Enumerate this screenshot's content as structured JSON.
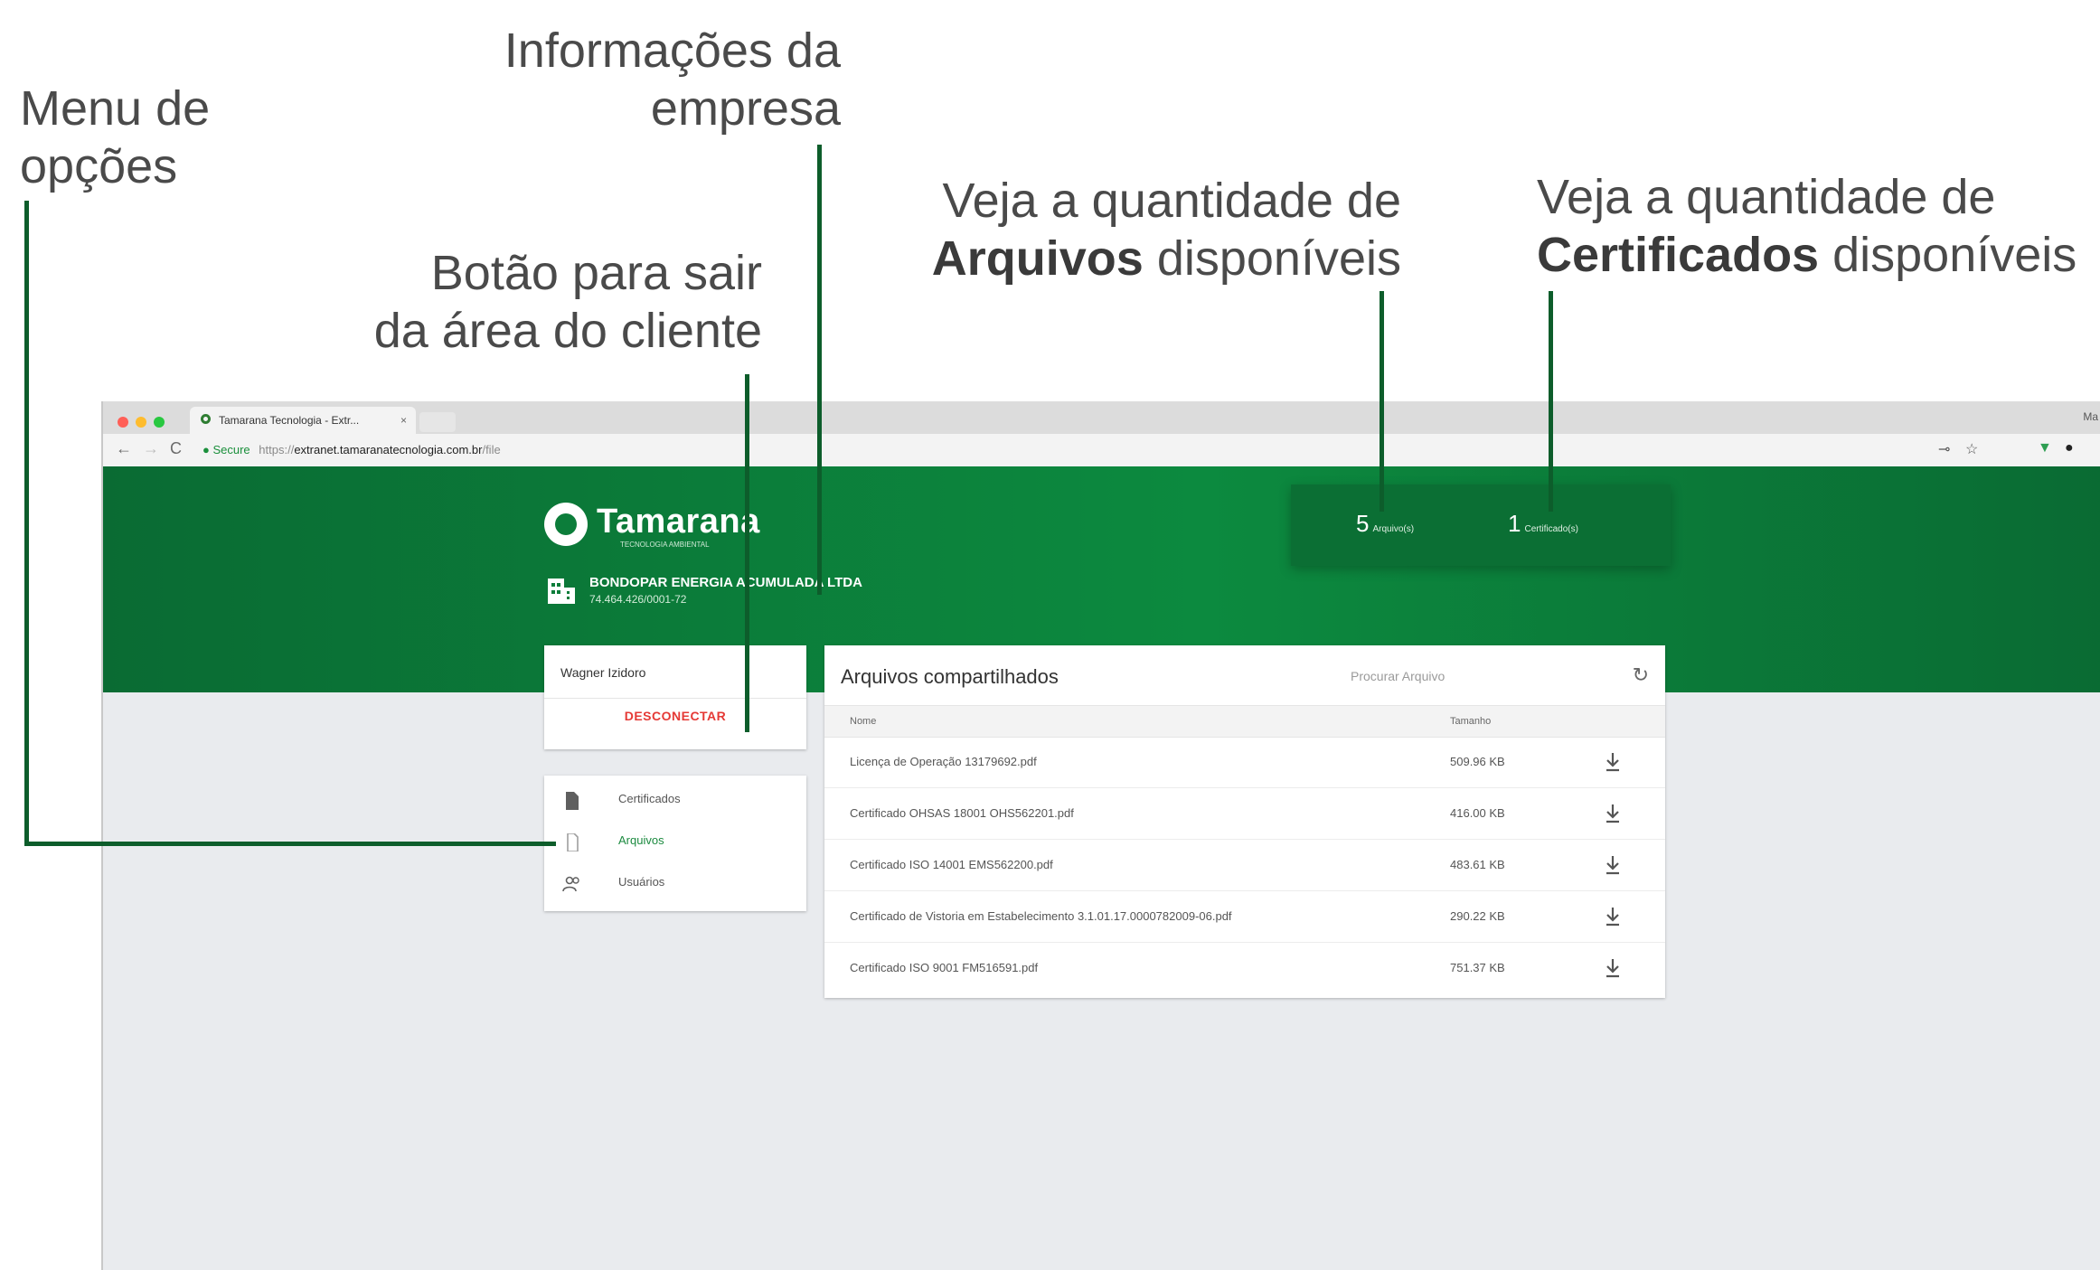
{
  "callouts": {
    "menu": [
      "Menu de",
      "opções"
    ],
    "company_info": [
      "Informações da",
      "empresa"
    ],
    "logout_button": [
      "Botão para sair",
      "da área do cliente"
    ],
    "files_count": {
      "line1": "Veja a quantidade de",
      "bold": "Arquivos",
      "rest": " disponíveis"
    },
    "certs_count": {
      "line1": "Veja a quantidade de",
      "bold": "Certificados",
      "rest": " disponíveis"
    }
  },
  "browser": {
    "tab_title": "Tamarana Tecnologia - Extr...",
    "tab_close": "×",
    "window_label": "Ma",
    "address": {
      "secure": "Secure",
      "scheme": "https://",
      "host": "extranet.tamaranatecnologia.com.br",
      "path": "/file"
    },
    "nav": {
      "back": "←",
      "forward": "→",
      "reload": "C"
    },
    "extensions": [
      "⊸",
      "☆",
      "▼",
      "●"
    ]
  },
  "brand": {
    "name": "Tamarana",
    "tagline": "TECNOLOGIA AMBIENTAL"
  },
  "company": {
    "name": "BONDOPAR ENERGIA ACUMULADA LTDA",
    "cnpj": "74.464.426/0001-72"
  },
  "stats": [
    {
      "value": "5",
      "label": "Arquivo(s)"
    },
    {
      "value": "1",
      "label": "Certificado(s)"
    }
  ],
  "user": {
    "name": "Wagner Izidoro",
    "logout_label": "DESCONECTAR"
  },
  "menu": [
    {
      "label": "Certificados",
      "icon": "document-icon",
      "active": false
    },
    {
      "label": "Arquivos",
      "icon": "file-icon",
      "active": true
    },
    {
      "label": "Usuários",
      "icon": "users-icon",
      "active": false
    }
  ],
  "files": {
    "title": "Arquivos compartilhados",
    "search_placeholder": "Procurar Arquivo",
    "refresh_icon": "↻",
    "columns": [
      "Nome",
      "Tamanho"
    ],
    "rows": [
      {
        "name": "Licença de Operação 13179692.pdf",
        "size": "509.96 KB"
      },
      {
        "name": "Certificado OHSAS 18001 OHS562201.pdf",
        "size": "416.00 KB"
      },
      {
        "name": "Certificado ISO 14001 EMS562200.pdf",
        "size": "483.61 KB"
      },
      {
        "name": "Certificado de Vistoria em Estabelecimento 3.1.01.17.0000782009-06.pdf",
        "size": "290.22 KB"
      },
      {
        "name": "Certificado ISO 9001 FM516591.pdf",
        "size": "751.37 KB"
      }
    ]
  },
  "colors": {
    "brand_green": "#0c8a3f",
    "leader_line": "#0d5d2b",
    "logout_red": "#e53935",
    "active_menu": "#1b8a3f"
  }
}
